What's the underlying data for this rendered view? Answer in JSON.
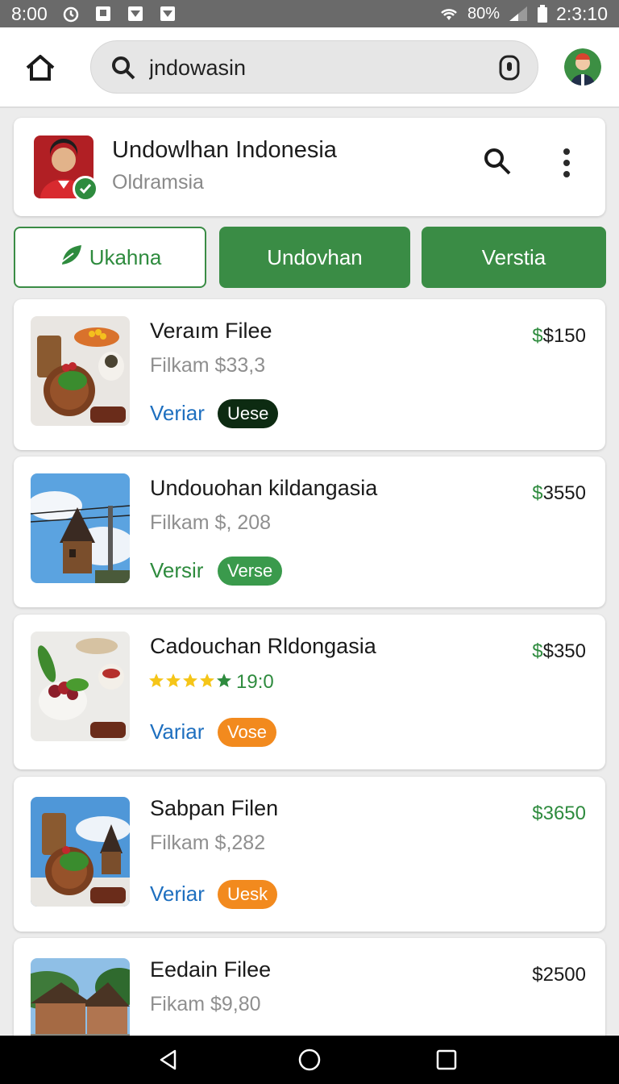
{
  "status_bar": {
    "time": "8:00",
    "battery_pct": "80%",
    "clock_right": "2:3:10"
  },
  "search": {
    "value": "jndowasin",
    "placeholder": "Search"
  },
  "profile": {
    "name": "Undowlhan Indonesia",
    "subtitle": "Oldramsia"
  },
  "tabs": [
    {
      "label": "Ukahna",
      "active": true
    },
    {
      "label": "Undovhan",
      "active": false
    },
    {
      "label": "Verstia",
      "active": false
    }
  ],
  "items": [
    {
      "title": "Veraım Filee",
      "meta": "Filkam $33,3",
      "price_symbol": "$",
      "price": "$150",
      "link": "Veriar",
      "link_color": "#1e6fbf",
      "chip": "Uese",
      "chip_bg": "#0d2b12",
      "chip_fg": "#ffffff",
      "thumb": "food"
    },
    {
      "title": "Undouohan kildangasia",
      "meta": "Filkam $, 208",
      "price_symbol": "$",
      "price": "3550",
      "link": "Versir",
      "link_color": "#2e8b3e",
      "chip": "Verse",
      "chip_bg": "#3a9a4c",
      "chip_fg": "#ffffff",
      "thumb": "sky"
    },
    {
      "title": "Cadouchan Rldongasia",
      "rating": "19:0",
      "stars": 5,
      "price_symbol": "$",
      "price": "$350",
      "link": "Variar",
      "link_color": "#1e6fbf",
      "chip": "Vose",
      "chip_bg": "#f28a1e",
      "chip_fg": "#ffffff",
      "thumb": "bowl"
    },
    {
      "title": "Sabpan Filen",
      "meta": "Filkam $,282",
      "price_symbol": "$",
      "price": "3650",
      "link": "Veriar",
      "link_color": "#1e6fbf",
      "chip": "Uesk",
      "chip_bg": "#f28a1e",
      "chip_fg": "#ffffff",
      "thumb": "mixed"
    },
    {
      "title": "Eedain Filee",
      "meta": "Fikam $9,80",
      "price_symbol": "",
      "price": "$2500",
      "thumb": "house"
    }
  ],
  "colors": {
    "accent_green": "#3a8c45",
    "link_blue": "#1e6fbf",
    "star_yellow": "#f5c518"
  },
  "icons": {
    "home": "home-icon",
    "search": "search-icon",
    "mic": "mic-icon",
    "more": "more-vert-icon",
    "nav_back": "nav-back-icon",
    "nav_home": "nav-home-icon",
    "nav_recents": "nav-recents-icon"
  }
}
